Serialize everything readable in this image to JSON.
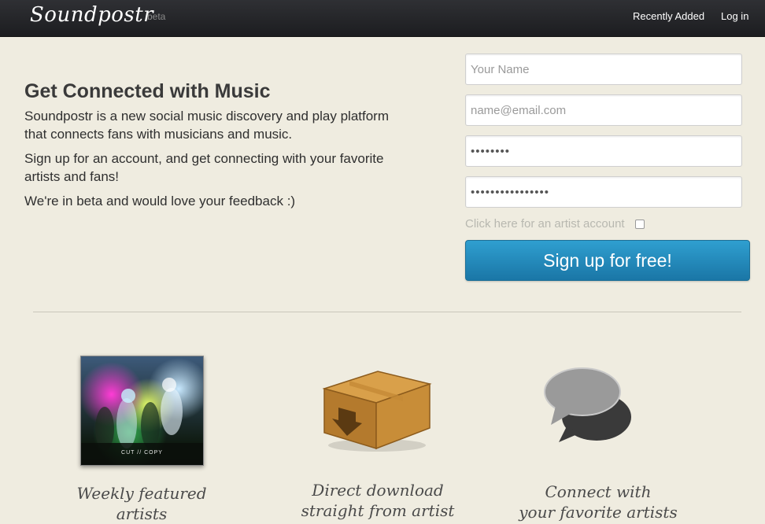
{
  "header": {
    "brand": "Soundpostr",
    "badge": "beta",
    "nav": {
      "recently_added": "Recently Added",
      "login": "Log in"
    }
  },
  "intro": {
    "headline": "Get Connected with Music",
    "paragraphs": [
      "Soundpostr is a new social music discovery and play platform that connects fans with musicians and music.",
      "Sign up for an account, and get connecting with your favorite artists and fans!",
      "We're in beta and would love your feedback :)"
    ]
  },
  "signup": {
    "name_placeholder": "Your Name",
    "email_placeholder": "name@email.com",
    "password_value": "••••••••",
    "password_confirm_value": "••••••••••••••••",
    "artist_account_label": "Click here for an artist account",
    "artist_account_checked": false,
    "submit_label": "Sign up for free!"
  },
  "features": [
    {
      "icon": "album-cover-image",
      "cover_text": "CUT // COPY",
      "caption_lines": [
        "Weekly featured",
        "artists"
      ]
    },
    {
      "icon": "download-box-icon",
      "caption_lines": [
        "Direct download",
        "straight from artist"
      ]
    },
    {
      "icon": "chat-bubbles-icon",
      "caption_lines": [
        "Connect with",
        "your favorite artists"
      ]
    }
  ],
  "colors": {
    "header_bg": "#1c1d20",
    "page_bg": "#efece0",
    "button_blue": "#2a8fc0",
    "box_brown": "#b9812f"
  }
}
